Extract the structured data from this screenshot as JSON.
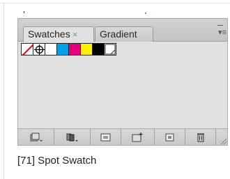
{
  "panel": {
    "tabs": [
      {
        "label": "Swatches",
        "active": true
      },
      {
        "label": "Gradient",
        "active": false
      }
    ],
    "close_glyph": "×"
  },
  "swatches": [
    {
      "name": "none-swatch"
    },
    {
      "name": "registration-swatch"
    },
    {
      "name": "paper-swatch",
      "color": "#ffffff"
    },
    {
      "name": "cyan-swatch",
      "color": "#00a0e8"
    },
    {
      "name": "magenta-swatch",
      "color": "#e5007e"
    },
    {
      "name": "yellow-swatch",
      "color": "#fff100"
    },
    {
      "name": "black-swatch",
      "color": "#000000"
    },
    {
      "name": "spot-swatch",
      "color": "#ffffff"
    }
  ],
  "bottom_toolbar": [
    "show-swatch-kinds-icon",
    "swatch-libraries-icon",
    "swatch-options-icon",
    "new-color-group-icon",
    "new-swatch-icon",
    "delete-swatch-icon"
  ],
  "caption": "[71] Spot Swatch"
}
